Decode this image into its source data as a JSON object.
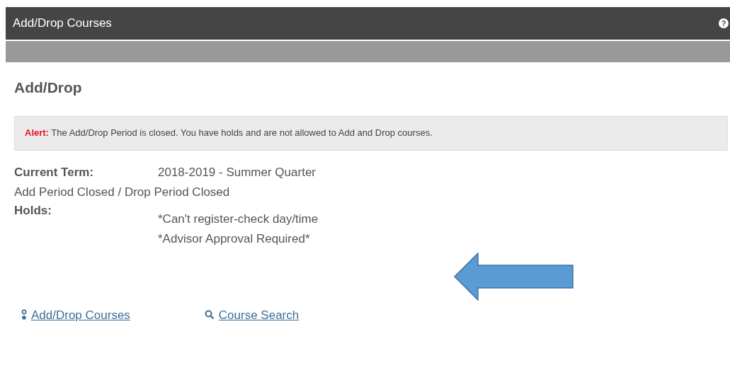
{
  "header": {
    "title": "Add/Drop Courses",
    "help": "?"
  },
  "page_title": "Add/Drop",
  "alert": {
    "label": "Alert:",
    "message": "The Add/Drop Period is closed. You have holds and are not allowed to Add and Drop courses."
  },
  "current_term": {
    "label": "Current Term:",
    "value": "2018-2019 - Summer Quarter"
  },
  "period_status": "Add Period Closed / Drop Period Closed",
  "holds": {
    "label": "Holds:",
    "items": [
      "*Can't register-check day/time",
      "*Advisor Approval Required*"
    ]
  },
  "links": [
    {
      "kind": "add_drop",
      "label": "Add/Drop Courses"
    },
    {
      "kind": "search",
      "label": "Course Search"
    }
  ]
}
